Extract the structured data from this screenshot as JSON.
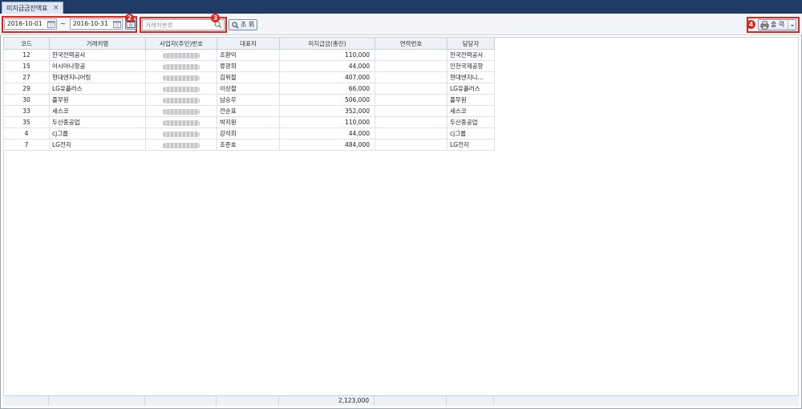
{
  "tab": {
    "title": "미지급금잔액표",
    "close": "×"
  },
  "toolbar": {
    "date_from": "2016-10-01",
    "date_sep": "~",
    "date_to": "2016-10-31",
    "category_placeholder": "거래처분류",
    "search_label": "조 회",
    "print_label": "출 력",
    "badges": [
      "2",
      "3",
      "4"
    ]
  },
  "table": {
    "headers": [
      "코드",
      "거래처명",
      "사업자(주민)번호",
      "대표자",
      "미지급금(총잔)",
      "연락번호",
      "담당자"
    ],
    "rows": [
      {
        "code": "12",
        "name": "한국전력공사",
        "rep": "조환익",
        "amount": "110,000",
        "manager": "한국전력공사"
      },
      {
        "code": "15",
        "name": "아시아나항공",
        "rep": "류광희",
        "amount": "44,000",
        "manager": "인천국제공항"
      },
      {
        "code": "27",
        "name": "현대엔지니어링",
        "rep": "김위철",
        "amount": "407,000",
        "manager": "현대엔지니…"
      },
      {
        "code": "29",
        "name": "LG유플러스",
        "rep": "이상철",
        "amount": "66,000",
        "manager": "LG유플러스"
      },
      {
        "code": "30",
        "name": "풀무원",
        "rep": "남승우",
        "amount": "506,000",
        "manager": "풀무원"
      },
      {
        "code": "33",
        "name": "세스코",
        "rep": "전순표",
        "amount": "352,000",
        "manager": "세스코"
      },
      {
        "code": "35",
        "name": "두산중공업",
        "rep": "박지원",
        "amount": "110,000",
        "manager": "두산중공업"
      },
      {
        "code": "4",
        "name": "cj그룹",
        "rep": "강석희",
        "amount": "44,000",
        "manager": "cj그룹"
      },
      {
        "code": "7",
        "name": "LG전자",
        "rep": "조준호",
        "amount": "484,000",
        "manager": "LG전자"
      }
    ],
    "total": "2,123,000"
  },
  "colors": {
    "topbar": "#1f3b66",
    "highlight": "#e2231a",
    "header": "#eef1f6"
  }
}
